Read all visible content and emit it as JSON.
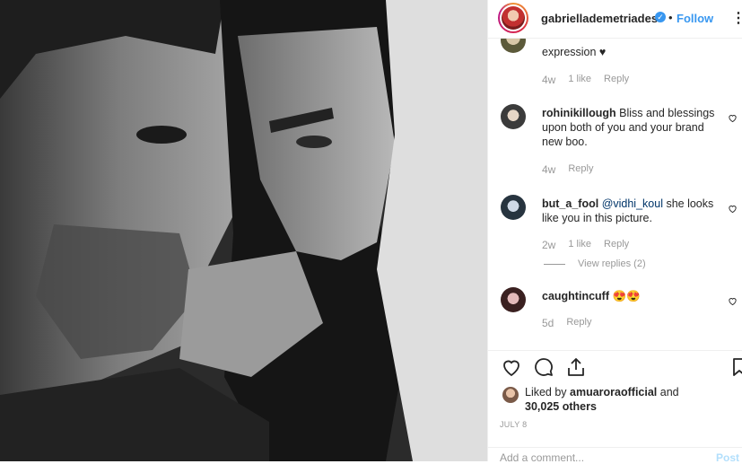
{
  "header": {
    "username": "gabriellademetriades",
    "verified_symbol": "✓",
    "separator": "•",
    "follow_label": "Follow",
    "more_label": "⋮"
  },
  "comments": [
    {
      "username": "",
      "text": "expression ♥",
      "age": "4w",
      "likes": "1 like",
      "reply_label": "Reply",
      "has_heart": false
    },
    {
      "username": "rohinikillough",
      "text": " Bliss and blessings upon both of you and your brand new boo.",
      "age": "4w",
      "likes": "",
      "reply_label": "Reply",
      "has_heart": true
    },
    {
      "username": "but_a_fool",
      "mention": "@vidhi_koul",
      "text": " she looks like you in this picture.",
      "age": "2w",
      "likes": "1 like",
      "reply_label": "Reply",
      "view_replies": "View replies (2)",
      "has_heart": true
    },
    {
      "username": "caughtincuff",
      "text": " 😍😍",
      "age": "5d",
      "likes": "",
      "reply_label": "Reply",
      "has_heart": true
    }
  ],
  "actions": {
    "icons": [
      "heart-icon",
      "comment-icon",
      "share-icon",
      "bookmark-icon"
    ]
  },
  "likes_summary": {
    "prefix": "Liked by ",
    "user": "amuaroraofficial",
    "middle": " and",
    "count": "30,025 others"
  },
  "date": "JULY 8",
  "add_comment": {
    "placeholder": "Add a comment...",
    "post_label": "Post"
  }
}
